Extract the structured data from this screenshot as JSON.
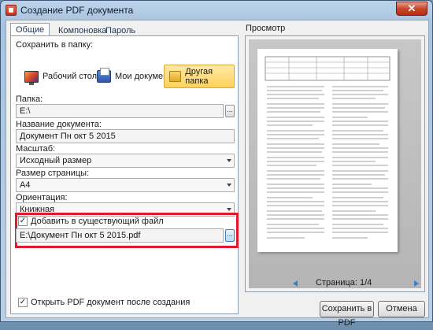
{
  "window": {
    "title": "Создание PDF документа",
    "close_glyph": "✕"
  },
  "tabs": [
    {
      "label": "Общие",
      "active": true
    },
    {
      "label": "Компоновка",
      "active": false
    },
    {
      "label": "Пароль",
      "active": false
    }
  ],
  "save_to": {
    "label": "Сохранить в папку:",
    "options": [
      {
        "label": "Рабочий стол",
        "icon": "desktop-icon",
        "selected": false
      },
      {
        "label": "Мои документы",
        "icon": "documents-icon",
        "selected": false
      },
      {
        "label": "Другая папка",
        "icon": "folder-icon",
        "selected": true
      }
    ]
  },
  "folder": {
    "label": "Папка:",
    "value": "E:\\",
    "browse": "..."
  },
  "doc_name": {
    "label": "Название документа:",
    "value": "Документ Пн окт 5 2015"
  },
  "scale": {
    "label": "Масштаб:",
    "value": "Исходный размер"
  },
  "page_size": {
    "label": "Размер страницы:",
    "value": "A4"
  },
  "orientation": {
    "label": "Ориентация:",
    "value": "Книжная"
  },
  "append": {
    "checked": true,
    "label": "Добавить в существующий файл",
    "value": "E:\\Документ Пн окт 5 2015.pdf",
    "browse": "..."
  },
  "open_after": {
    "checked": true,
    "label": "Открыть PDF документ после создания"
  },
  "preview": {
    "label": "Просмотр",
    "page_indicator": "Страница: 1/4"
  },
  "buttons": {
    "save_pdf": "Сохранить в PDF",
    "cancel": "Отмена"
  },
  "colors": {
    "highlight_border": "#e0192c",
    "selected_bg": "#ffd35a",
    "accent": "#3a83c8"
  }
}
